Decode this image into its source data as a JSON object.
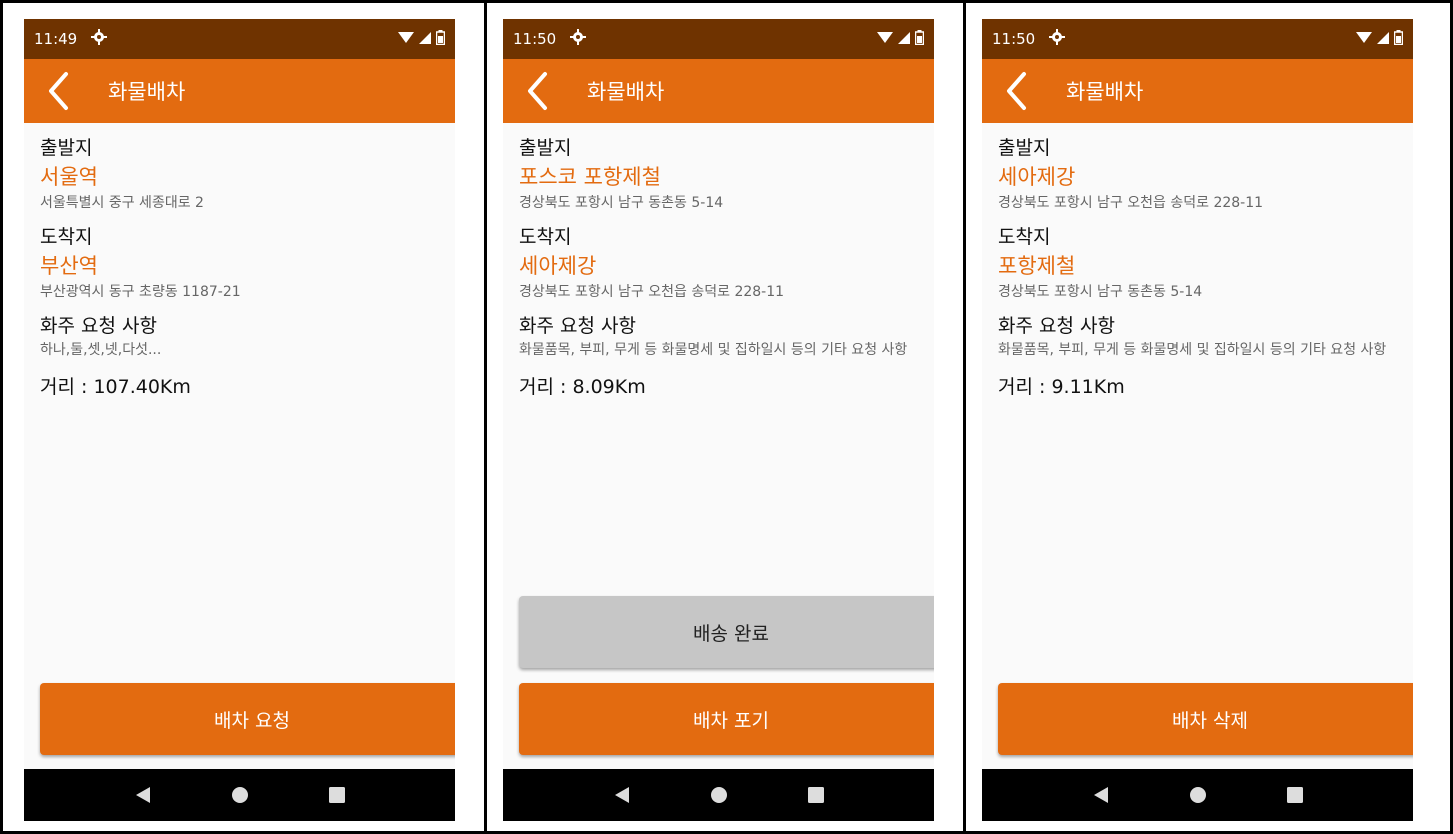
{
  "screens": [
    {
      "status_time": "11:49",
      "app_title": "화물배차",
      "departure_label": "출발지",
      "departure_name": "서울역",
      "departure_address": "서울특별시 중구 세종대로 2",
      "arrival_label": "도착지",
      "arrival_name": "부산역",
      "arrival_address": "부산광역시 동구 초량동 1187-21",
      "request_label": "화주 요청 사항",
      "request_text": "하나,둘,셋,넷,다섯...",
      "distance": "거리 : 107.40Km",
      "primary_button": "배차 요청"
    },
    {
      "status_time": "11:50",
      "app_title": "화물배차",
      "departure_label": "출발지",
      "departure_name": "포스코 포항제철",
      "departure_address": "경상북도 포항시 남구 동촌동 5-14",
      "arrival_label": "도착지",
      "arrival_name": "세아제강",
      "arrival_address": "경상북도 포항시 남구 오천읍 송덕로 228-11",
      "request_label": "화주 요청 사항",
      "request_text": "화물품목, 부피, 무게 등 화물명세 및 집하일시 등의 기타 요청 사항",
      "distance": "거리 : 8.09Km",
      "secondary_button": "배송 완료",
      "primary_button": "배차 포기"
    },
    {
      "status_time": "11:50",
      "app_title": "화물배차",
      "departure_label": "출발지",
      "departure_name": "세아제강",
      "departure_address": "경상북도 포항시 남구 오천읍 송덕로 228-11",
      "arrival_label": "도착지",
      "arrival_name": "포항제철",
      "arrival_address": "경상북도 포항시 남구 동촌동 5-14",
      "request_label": "화주 요청 사항",
      "request_text": "화물품목, 부피, 무게 등 화물명세 및 집하일시 등의 기타 요청 사항",
      "distance": "거리 : 9.11Km",
      "primary_button": "배차 삭제"
    }
  ],
  "colors": {
    "status_bar": "#6f3300",
    "app_bar": "#e36b10",
    "accent_text": "#e36b10",
    "secondary_button": "#c6c6c6",
    "nav_bar": "#000000"
  },
  "icons": {
    "status_left": "gear-icon",
    "status_right": [
      "wifi-icon",
      "signal-icon",
      "battery-icon"
    ],
    "app_bar": "back-arrow-icon",
    "nav": [
      "nav-back-icon",
      "nav-home-icon",
      "nav-recents-icon"
    ]
  }
}
